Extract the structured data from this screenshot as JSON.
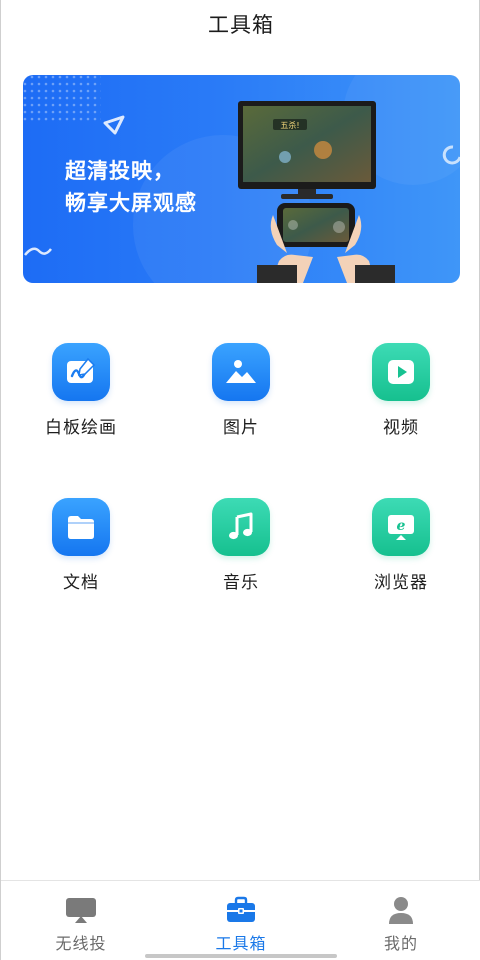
{
  "header": {
    "title": "工具箱"
  },
  "banner": {
    "line1": "超清投映，",
    "line2": "畅享大屏观感",
    "game_tag": "五杀!"
  },
  "tools": [
    {
      "label": "白板绘画",
      "icon": "whiteboard-icon",
      "color": "blue"
    },
    {
      "label": "图片",
      "icon": "image-icon",
      "color": "blue"
    },
    {
      "label": "视频",
      "icon": "video-icon",
      "color": "green"
    },
    {
      "label": "文档",
      "icon": "folder-icon",
      "color": "blue"
    },
    {
      "label": "音乐",
      "icon": "music-icon",
      "color": "green"
    },
    {
      "label": "浏览器",
      "icon": "browser-icon",
      "color": "green"
    }
  ],
  "bottom_nav": {
    "items": [
      {
        "label": "无线投",
        "icon": "cast-icon",
        "active": false
      },
      {
        "label": "工具箱",
        "icon": "toolbox-icon",
        "active": true
      },
      {
        "label": "我的",
        "icon": "profile-icon",
        "active": false
      }
    ],
    "active_color": "#1a78e8",
    "inactive_color": "#6b6b6b"
  }
}
